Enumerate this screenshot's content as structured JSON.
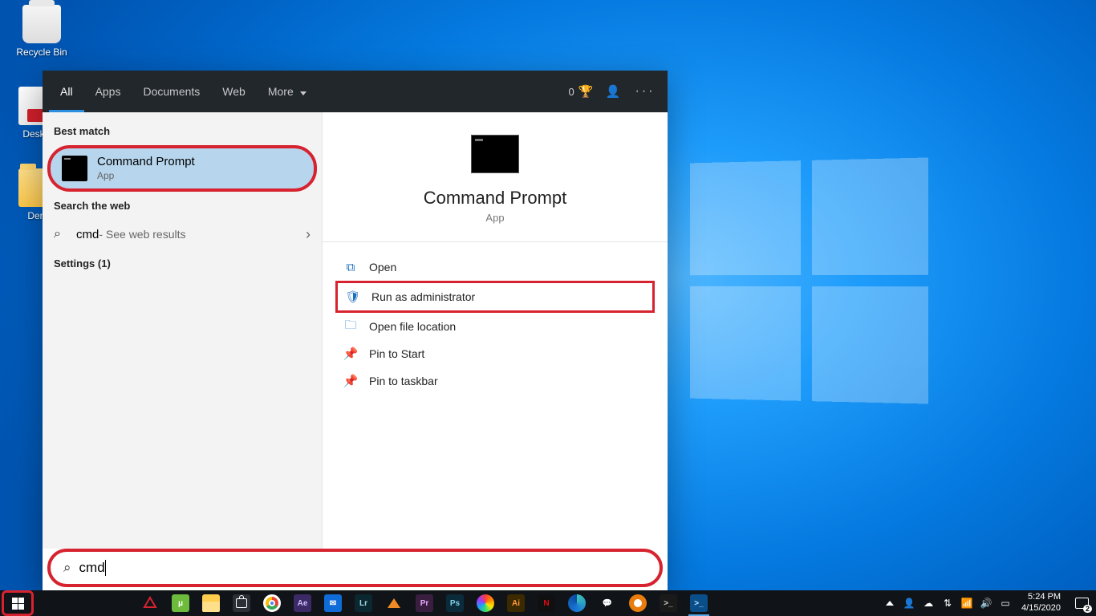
{
  "desktop_icons": {
    "recycle": "Recycle Bin",
    "desktop": "Deskto",
    "demo": "Dem"
  },
  "search": {
    "tabs": [
      "All",
      "Apps",
      "Documents",
      "Web",
      "More"
    ],
    "tab_more_caret": "▼",
    "points": "0",
    "sections": {
      "best": "Best match",
      "web": "Search the web",
      "settings": "Settings (1)"
    },
    "best_result": {
      "title": "Command Prompt",
      "sub": "App"
    },
    "web_result": {
      "term": "cmd",
      "suffix": " - See web results"
    },
    "preview": {
      "title": "Command Prompt",
      "sub": "App"
    },
    "actions": {
      "open": "Open",
      "admin": "Run as administrator",
      "location": "Open file location",
      "pin_start": "Pin to Start",
      "pin_taskbar": "Pin to taskbar"
    },
    "query": "cmd"
  },
  "taskbar": {
    "apps": [
      {
        "name": "comodo",
        "bg": "#c1272d",
        "txt": "",
        "fg": "#fff"
      },
      {
        "name": "utorrent",
        "bg": "#6cbb3c",
        "txt": "μ",
        "fg": "#fff"
      },
      {
        "name": "file-explorer",
        "bg": "#ffcc4d",
        "txt": "",
        "fg": "#7a5a00"
      },
      {
        "name": "microsoft-store",
        "bg": "#2b2f36",
        "txt": "",
        "fg": "#fff"
      },
      {
        "name": "chrome",
        "bg": "#fff",
        "txt": "",
        "fg": "#777",
        "round": true
      },
      {
        "name": "after-effects",
        "bg": "#3b2a66",
        "txt": "Ae",
        "fg": "#cfbaff"
      },
      {
        "name": "mail",
        "bg": "#0f6bd8",
        "txt": "✉",
        "fg": "#fff"
      },
      {
        "name": "lightroom",
        "bg": "#0b2730",
        "txt": "Lr",
        "fg": "#9fd8e6"
      },
      {
        "name": "vlc",
        "bg": "#f08a24",
        "txt": "",
        "fg": "#fff",
        "tri": true
      },
      {
        "name": "premiere",
        "bg": "#3a1e3f",
        "txt": "Pr",
        "fg": "#e6a8ff"
      },
      {
        "name": "photoshop",
        "bg": "#0b2b3b",
        "txt": "Ps",
        "fg": "#7fd0ea"
      },
      {
        "name": "davinci",
        "bg": "#1a1a1a",
        "txt": "",
        "fg": "#fff",
        "round": true,
        "grad": true
      },
      {
        "name": "illustrator",
        "bg": "#3b2a00",
        "txt": "Ai",
        "fg": "#ff9a3c"
      },
      {
        "name": "netflix",
        "bg": "#101010",
        "txt": "N",
        "fg": "#e50914"
      },
      {
        "name": "edge",
        "bg": "#1a1a1a",
        "txt": "",
        "fg": "#fff",
        "round": true,
        "edge": true
      },
      {
        "name": "chat",
        "bg": "#101318",
        "txt": "💬",
        "fg": "#fff",
        "nobg": true
      },
      {
        "name": "blender",
        "bg": "#e87d0d",
        "txt": "",
        "fg": "#fff",
        "round": true
      },
      {
        "name": "terminal",
        "bg": "#1a1a1a",
        "txt": ">_",
        "fg": "#ccc"
      },
      {
        "name": "powershell",
        "bg": "#0b4f8a",
        "txt": ">_",
        "fg": "#bfe4ff",
        "active": true
      }
    ],
    "clock": {
      "time": "5:24 PM",
      "date": "4/15/2020"
    },
    "notifications": "2"
  }
}
